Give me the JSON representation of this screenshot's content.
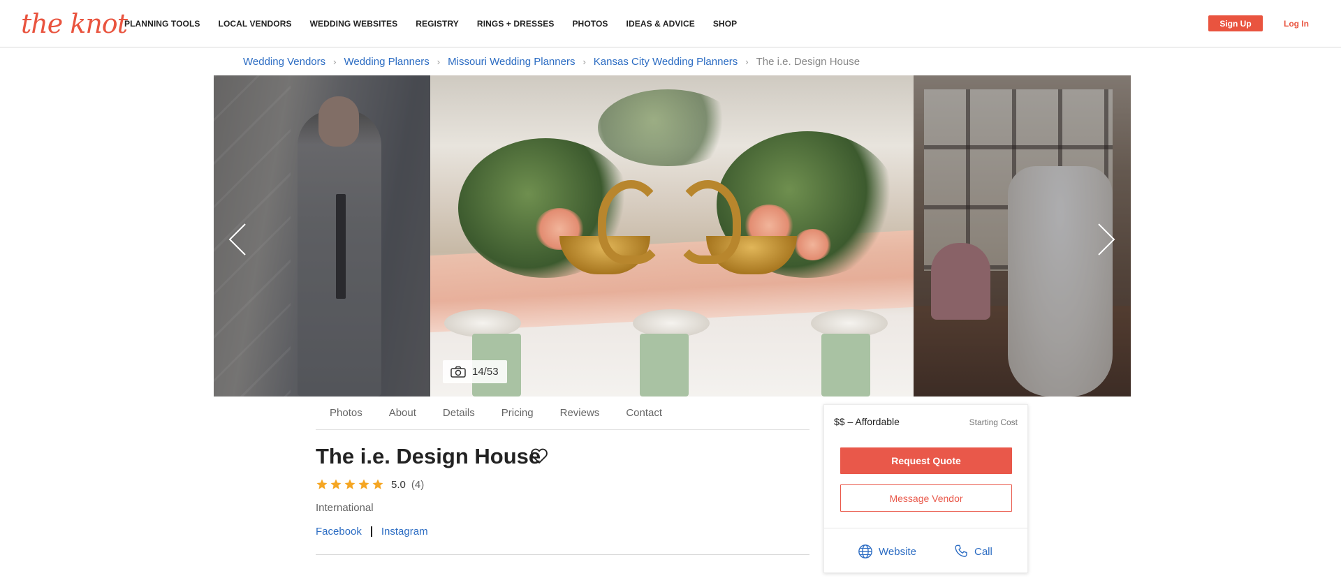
{
  "header": {
    "logo_text": "the knot",
    "nav": [
      {
        "label": "PLANNING TOOLS"
      },
      {
        "label": "LOCAL VENDORS"
      },
      {
        "label": "WEDDING WEBSITES"
      },
      {
        "label": "REGISTRY"
      },
      {
        "label": "RINGS + DRESSES"
      },
      {
        "label": "PHOTOS"
      },
      {
        "label": "IDEAS & ADVICE"
      },
      {
        "label": "SHOP"
      }
    ],
    "signup_label": "Sign Up",
    "login_label": "Log In"
  },
  "breadcrumb": {
    "items": [
      "Wedding Vendors",
      "Wedding Planners",
      "Missouri Wedding Planners",
      "Kansas City Wedding Planners"
    ],
    "current": "The i.e. Design House"
  },
  "gallery": {
    "counter": "14/53"
  },
  "tabs": [
    "Photos",
    "About",
    "Details",
    "Pricing",
    "Reviews",
    "Contact"
  ],
  "vendor": {
    "name": "The i.e. Design House",
    "rating": "5.0",
    "rating_stars": 5,
    "review_count": "(4)",
    "location": "International",
    "social": [
      "Facebook",
      "Instagram"
    ]
  },
  "pricing_card": {
    "price_tier": "$$ – Affordable",
    "starting_cost": "Starting Cost",
    "request_quote": "Request Quote",
    "message_vendor": "Message Vendor",
    "website": "Website",
    "call": "Call"
  },
  "colors": {
    "brand": "#e9543f",
    "link": "#2d6dc3",
    "star": "#f5a623"
  },
  "icons": {
    "prev": "chevron-left-icon",
    "next": "chevron-right-icon",
    "counter": "camera-icon",
    "favorite": "heart-icon",
    "website": "globe-icon",
    "call": "phone-icon"
  }
}
